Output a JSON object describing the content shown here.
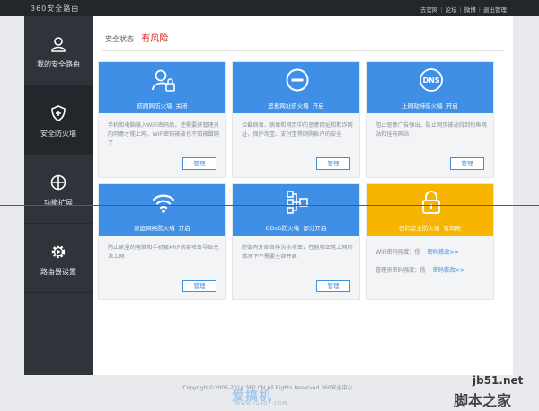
{
  "header": {
    "logo_text": "360安全路由",
    "links": [
      "去官网",
      "论坛",
      "微博",
      "退出管理"
    ]
  },
  "sidebar": {
    "items": [
      {
        "label": "我的安全路由",
        "icon": "user-icon"
      },
      {
        "label": "安全防火墙",
        "icon": "shield-icon",
        "active": true
      },
      {
        "label": "功能扩展",
        "icon": "grid-circle-icon"
      },
      {
        "label": "路由器设置",
        "icon": "gear-icon"
      }
    ]
  },
  "status": {
    "label": "安全状态",
    "value": "有风险"
  },
  "cards": [
    {
      "title": "防蹭网防火墙",
      "state": "关闭",
      "icon": "user-lock-icon",
      "desc": "手机和电脑输入WiFi密码后，还需要获管理员的同意才能上网。WiFi密码被破也不怕被蹭网了",
      "button": "管理"
    },
    {
      "title": "恶意网址防火墙",
      "state": "开启",
      "icon": "no-entry-icon",
      "desc": "拦截病毒、病毒和网页中的恶意网址和欺诈网址，保护淘宝、支付宝等网购账户的安全",
      "button": "管理"
    },
    {
      "title": "上网劫持防火墙",
      "state": "开启",
      "icon": "dns-icon",
      "desc": "阻止恶意广告弹出，防止网页被劫持到钓鱼网站和挂马网站",
      "button": "管理"
    },
    {
      "title": "家庭网络防火墙",
      "state": "开启",
      "icon": "wifi-icon",
      "desc": "防止家里的电脑和手机被ARP病毒攻击导致无法上网",
      "button": "管理"
    },
    {
      "title": "DDoS防火墙",
      "state": "部分开启",
      "icon": "network-icon",
      "desc": "防御内外部各种洪水攻击，在能够正常上网的情况下不需要全部开启",
      "button": "管理"
    },
    {
      "title": "密码安全防火墙",
      "state": "有风险",
      "icon": "lock-icon",
      "rows": [
        {
          "label": "WiFi密码强度：低",
          "link": "密码修改>>"
        },
        {
          "label": "管理员密码强度：低",
          "link": "密码修改>>"
        }
      ]
    }
  ],
  "footer": {
    "copyright": "Copyright©2005-2014 360.CN All Rights Reserved 360安全中心"
  },
  "watermarks": {
    "site1": "爱搞机",
    "site1_sub": "WWW.IGAO7.COM",
    "site2": "jb51.net",
    "site3": "脚本之家"
  }
}
